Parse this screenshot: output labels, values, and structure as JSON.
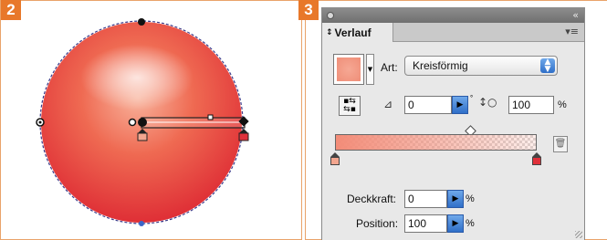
{
  "steps": {
    "left": "2",
    "right": "3"
  },
  "panel": {
    "tab_label": "Verlauf",
    "tab_arrows": "↕",
    "collapse_glyph": "«",
    "menu_glyph": "▾≡",
    "type_label": "Art:",
    "type_value": "Kreisförmig",
    "angle_value": "0",
    "degree_symbol": "°",
    "aspect_value": "100",
    "percent": "%",
    "opacity_label": "Deckkraft:",
    "opacity_value": "0",
    "position_label": "Position:",
    "position_value": "100"
  },
  "colors": {
    "accent": "#e8782a",
    "sphere_light": "#f8b39c",
    "sphere_dark": "#e0303a",
    "stop_left": "#f3a68f",
    "stop_right": "#e0303a"
  },
  "icons": [
    "reverse-gradient-icon",
    "angle-icon",
    "aspect-ratio-icon",
    "trash-icon",
    "dropdown-arrow-icon"
  ]
}
